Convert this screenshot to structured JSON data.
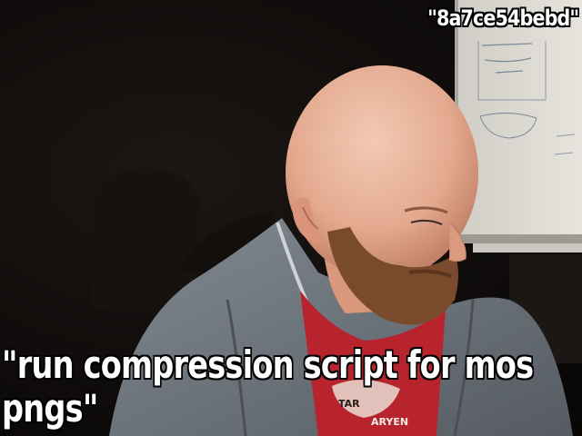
{
  "captions": {
    "top": "\"8a7ce54bebd\"",
    "bottom_line1": "\"run compression script for mos",
    "bottom_line2": "pngs\""
  },
  "shirt_print": {
    "left": "TAR",
    "right": "ARYEN"
  },
  "colors": {
    "background": "#0f0c0b",
    "whiteboard": "#d9d7cf",
    "skin": "#e3a98f",
    "beard": "#7a4a2c",
    "hoodie": "#6f757c",
    "shirt": "#b8242d",
    "caption_text": "#ffffff",
    "caption_outline": "#000000"
  }
}
